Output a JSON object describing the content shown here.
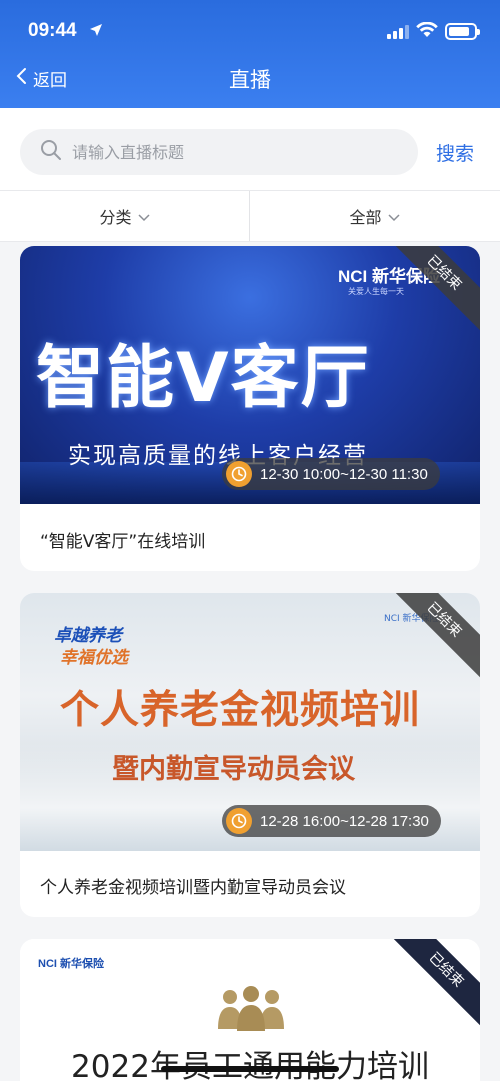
{
  "status": {
    "time": "09:44"
  },
  "nav": {
    "back_label": "返回",
    "title": "直播"
  },
  "search": {
    "placeholder": "请输入直播标题",
    "button_label": "搜索"
  },
  "filters": {
    "category_label": "分类",
    "status_label": "全部"
  },
  "cards": [
    {
      "banner_logo": "NCI 新华保险",
      "banner_logo_sub": "关爱人生每一天",
      "banner_title": "智能V客厅",
      "banner_subtitle": "实现高质量的线上客户经营",
      "badge": "已结束",
      "time": "12-30 10:00~12-30 11:30",
      "caption": "“智能V客厅”在线培训"
    },
    {
      "banner_logo": "NCI 新华保险",
      "banner_slogan1": "卓越养老",
      "banner_slogan2": "幸福优选",
      "banner_title": "个人养老金视频培训",
      "banner_subtitle": "暨内勤宣导动员会议",
      "badge": "已结束",
      "time": "12-28 16:00~12-28 17:30",
      "caption": "个人养老金视频培训暨内勤宣导动员会议"
    },
    {
      "banner_logo": "NCI 新华保险",
      "banner_title": "2022年员工通用能力培训",
      "badge": "已结束"
    }
  ],
  "colors": {
    "primary": "#2f6fe4",
    "badge_bg": "#3c3c3c",
    "clock": "#f0a030"
  }
}
